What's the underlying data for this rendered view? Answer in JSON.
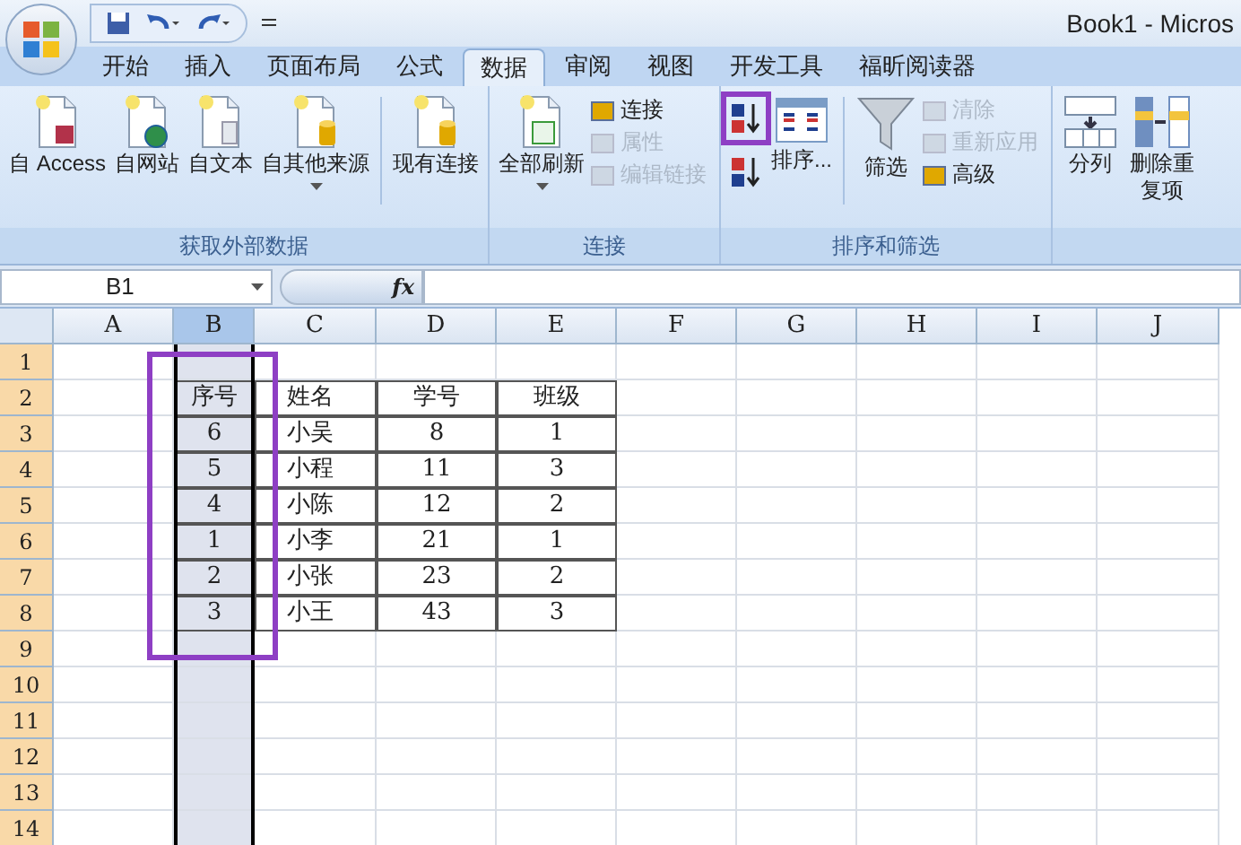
{
  "title_bar": {
    "title": "Book1 - Micros"
  },
  "tabs": [
    {
      "label": "开始",
      "selected": false
    },
    {
      "label": "插入",
      "selected": false
    },
    {
      "label": "页面布局",
      "selected": false
    },
    {
      "label": "公式",
      "selected": false
    },
    {
      "label": "数据",
      "selected": true
    },
    {
      "label": "审阅",
      "selected": false
    },
    {
      "label": "视图",
      "selected": false
    },
    {
      "label": "开发工具",
      "selected": false
    },
    {
      "label": "福昕阅读器",
      "selected": false
    }
  ],
  "ribbon": {
    "groups": [
      {
        "label": "获取外部数据",
        "items": [
          {
            "kind": "large",
            "label": "自 Access",
            "dropdown": false
          },
          {
            "kind": "large",
            "label": "自网站",
            "dropdown": false
          },
          {
            "kind": "large",
            "label": "自文本",
            "dropdown": false
          },
          {
            "kind": "large",
            "label": "自其他来源",
            "dropdown": true
          },
          {
            "kind": "separator"
          },
          {
            "kind": "large",
            "label": "现有连接",
            "dropdown": false
          }
        ]
      },
      {
        "label": "连接",
        "items": [
          {
            "kind": "large",
            "label": "全部刷新",
            "dropdown": true
          },
          {
            "kind": "stack",
            "buttons": [
              {
                "label": "连接",
                "disabled": false
              },
              {
                "label": "属性",
                "disabled": true
              },
              {
                "label": "编辑链接",
                "disabled": true
              }
            ]
          }
        ]
      },
      {
        "label": "排序和筛选",
        "items": [
          {
            "kind": "sortpair",
            "highlighted": true
          },
          {
            "kind": "large",
            "label": "排序...",
            "dropdown": false
          },
          {
            "kind": "separator"
          },
          {
            "kind": "large",
            "label": "筛选",
            "dropdown": false
          },
          {
            "kind": "stack",
            "buttons": [
              {
                "label": "清除",
                "disabled": true
              },
              {
                "label": "重新应用",
                "disabled": true
              },
              {
                "label": "高级",
                "disabled": false
              }
            ]
          }
        ]
      },
      {
        "items": [
          {
            "kind": "large",
            "label": "分列",
            "dropdown": false
          },
          {
            "kind": "large",
            "label": "删除重复项",
            "dropdown": false
          }
        ]
      }
    ]
  },
  "formula_bar": {
    "name_box": "B1",
    "function_label": "fx"
  },
  "sheet": {
    "columns": [
      {
        "label": "A",
        "selected": false
      },
      {
        "label": "B",
        "selected": true,
        "highlighted": true
      },
      {
        "label": "C",
        "selected": false
      },
      {
        "label": "D",
        "selected": false
      },
      {
        "label": "E",
        "selected": false
      },
      {
        "label": "F",
        "selected": false
      },
      {
        "label": "G",
        "selected": false
      },
      {
        "label": "H",
        "selected": false
      },
      {
        "label": "I",
        "selected": false
      },
      {
        "label": "J",
        "selected": false
      }
    ],
    "rows": [
      {
        "label": "1",
        "selected": true,
        "cells": {}
      },
      {
        "label": "2",
        "selected": true,
        "cells": {
          "B": "序号",
          "C": "姓名",
          "D": "学号",
          "E": "班级"
        }
      },
      {
        "label": "3",
        "selected": true,
        "cells": {
          "B": "6",
          "C": "小吴",
          "D": "8",
          "E": "1"
        }
      },
      {
        "label": "4",
        "selected": true,
        "cells": {
          "B": "5",
          "C": "小程",
          "D": "11",
          "E": "3"
        }
      },
      {
        "label": "5",
        "selected": true,
        "cells": {
          "B": "4",
          "C": "小陈",
          "D": "12",
          "E": "2"
        }
      },
      {
        "label": "6",
        "selected": true,
        "cells": {
          "B": "1",
          "C": "小李",
          "D": "21",
          "E": "1"
        }
      },
      {
        "label": "7",
        "selected": true,
        "cells": {
          "B": "2",
          "C": "小张",
          "D": "23",
          "E": "2"
        }
      },
      {
        "label": "8",
        "selected": true,
        "cells": {
          "B": "3",
          "C": "小王",
          "D": "43",
          "E": "3"
        }
      },
      {
        "label": "9",
        "selected": true,
        "cells": {}
      },
      {
        "label": "10",
        "selected": true,
        "cells": {}
      },
      {
        "label": "11",
        "selected": true,
        "cells": {}
      },
      {
        "label": "12",
        "selected": true,
        "cells": {}
      },
      {
        "label": "13",
        "selected": true,
        "cells": {}
      },
      {
        "label": "14",
        "selected": true,
        "cells": {}
      }
    ]
  }
}
